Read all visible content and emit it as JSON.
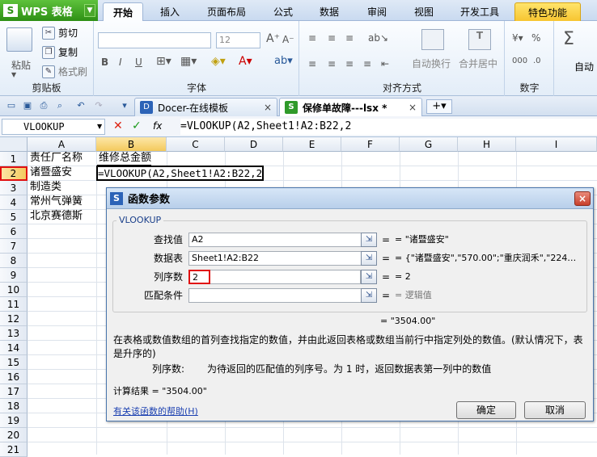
{
  "app": {
    "button_label": "WPS 表格",
    "logo_letter": "S"
  },
  "ribbon_tabs": [
    "开始",
    "插入",
    "页面布局",
    "公式",
    "数据",
    "审阅",
    "视图",
    "开发工具",
    "特色功能"
  ],
  "ribbon": {
    "clipboard": {
      "paste": "粘贴",
      "cut": "剪切",
      "copy": "复制",
      "format_painter": "格式刷",
      "group": "剪贴板"
    },
    "font": {
      "font_size": "12",
      "group": "字体"
    },
    "alignment": {
      "wrap": "自动换行",
      "merge": "合并居中",
      "group": "对齐方式"
    },
    "number": {
      "group": "数字"
    },
    "auto_sum": "自动"
  },
  "doc_tabs": [
    {
      "label": "Docer-在线模板",
      "close": "×"
    },
    {
      "label": "保修单故障---lsx *",
      "close": "×"
    }
  ],
  "formula_bar": {
    "name_box": "VLOOKUP",
    "cancel": "✕",
    "confirm": "✓",
    "fx": "fx",
    "formula": "=VLOOKUP(A2,Sheet1!A2:B22,2"
  },
  "columns": [
    "A",
    "B",
    "C",
    "D",
    "E",
    "F",
    "G",
    "H",
    "I"
  ],
  "rows": [
    "1",
    "2",
    "3",
    "4",
    "5",
    "6",
    "7",
    "8",
    "9",
    "10",
    "11",
    "12",
    "13",
    "14",
    "15",
    "16",
    "17",
    "18",
    "19",
    "20",
    "21"
  ],
  "cells": {
    "A1": "责任厂名称",
    "B1": "维修总金额",
    "A2": "诸暨盛安",
    "B2": "=VLOOKUP(A2,Sheet1!A2:B22,2",
    "A3": "制造类",
    "A4": "常州气弹簧",
    "A5": "北京赛德斯"
  },
  "dialog": {
    "title": "函数参数",
    "logo_letter": "S",
    "close": "×",
    "function_name": "VLOOKUP",
    "params": [
      {
        "label": "查找值",
        "value": "A2",
        "result": "= \"诸暨盛安\""
      },
      {
        "label": "数据表",
        "value": "Sheet1!A2:B22",
        "result": "= {\"诸暨盛安\",\"570.00\";\"重庆润禾\",\"224…"
      },
      {
        "label": "列序数",
        "value": "2",
        "result": "= 2"
      },
      {
        "label": "匹配条件",
        "value": "",
        "result": "= 逻辑值"
      }
    ],
    "overall_result": "= \"3504.00\"",
    "description": "在表格或数值数组的首列查找指定的数值，并由此返回表格或数组当前行中指定列处的数值。(默认情况下，表是升序的)",
    "param_help_name": "列序数:",
    "param_help_text": "为待返回的匹配值的列序号。为 1 时，返回数据表第一列中的数值",
    "calc_result": "计算结果 = \"3504.00\"",
    "help_link": "有关该函数的帮助(H)",
    "ok": "确定",
    "cancel": "取消"
  }
}
